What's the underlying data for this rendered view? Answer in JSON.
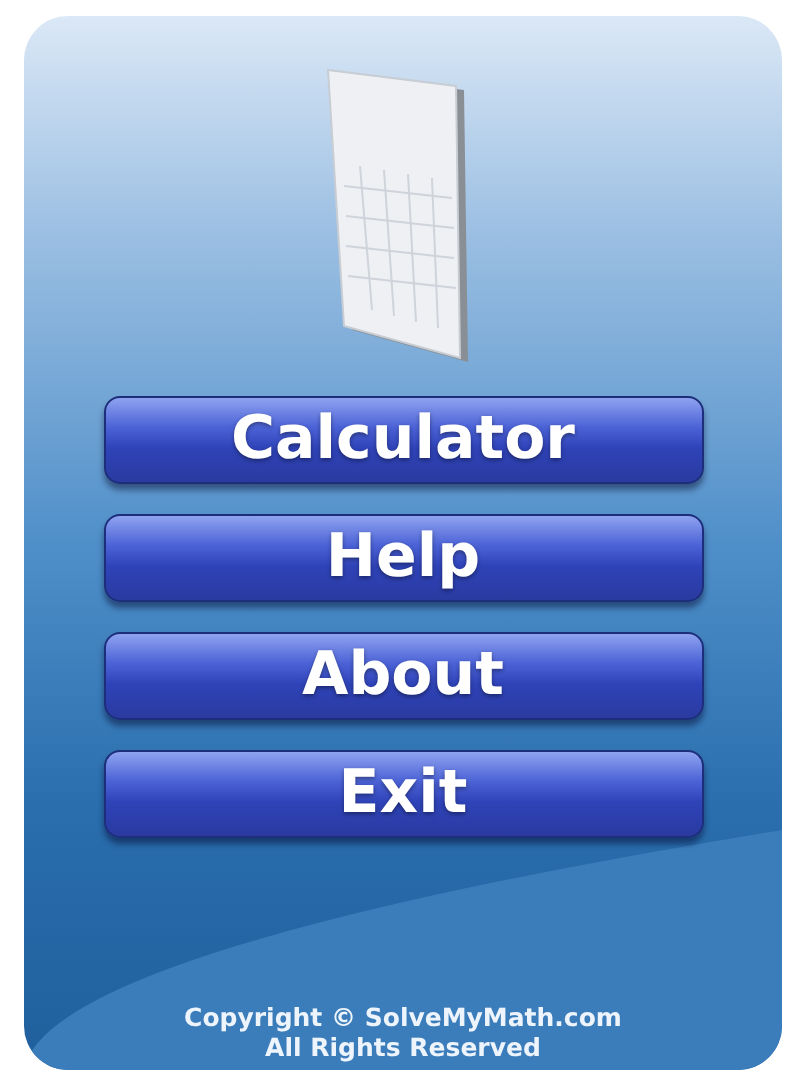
{
  "menu": [
    {
      "label": "Calculator"
    },
    {
      "label": "Help"
    },
    {
      "label": "About"
    },
    {
      "label": "Exit"
    }
  ],
  "footer": [
    "Copyright © SolveMyMath.com",
    "All Rights Reserved"
  ]
}
